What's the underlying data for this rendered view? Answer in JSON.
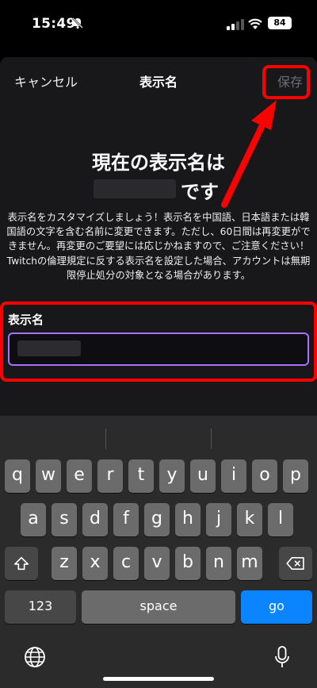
{
  "status": {
    "time": "15:49",
    "battery": "84"
  },
  "header": {
    "cancel": "キャンセル",
    "title": "表示名",
    "save": "保存"
  },
  "headline": {
    "line1": "現在の表示名は",
    "suffix": "です"
  },
  "description": "表示名をカスタマイズしましょう！表示名を中国語、日本語または韓国語の文字を含む名前に変更できます。ただし、60日間は再変更ができません。再変更のご要望には応じかねますので、ご注意ください！Twitchの倫理規定に反する表示名を設定した場合、アカウントは無期限停止処分の対象となる場合があります。",
  "field": {
    "label": "表示名"
  },
  "keyboard": {
    "row1": [
      "q",
      "w",
      "e",
      "r",
      "t",
      "y",
      "u",
      "i",
      "o",
      "p"
    ],
    "row2": [
      "a",
      "s",
      "d",
      "f",
      "g",
      "h",
      "j",
      "k",
      "l"
    ],
    "row3": [
      "z",
      "x",
      "c",
      "v",
      "b",
      "n",
      "m"
    ],
    "numbers": "123",
    "space": "space",
    "go": "go"
  },
  "colors": {
    "accent": "#a970ff",
    "highlight": "#ff0000",
    "go": "#0a84ff"
  }
}
